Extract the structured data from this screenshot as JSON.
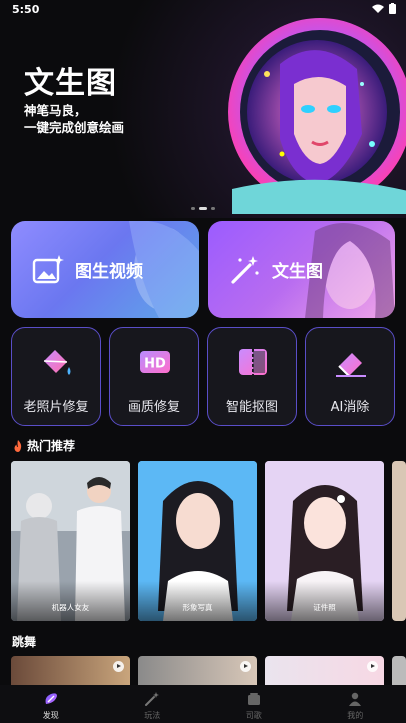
{
  "status_bar": {
    "time": "5:50"
  },
  "hero": {
    "title": "文生图",
    "subtitle_line1": "神笔马良，",
    "subtitle_line2": "一键完成创意绘画"
  },
  "features": [
    {
      "label": "图生视频",
      "icon": "image-sparkle-icon"
    },
    {
      "label": "文生图",
      "icon": "magic-wand-icon"
    }
  ],
  "tools": [
    {
      "label": "老照片修复",
      "icon": "paint-bucket-icon"
    },
    {
      "label": "画质修复",
      "icon": "hd-icon"
    },
    {
      "label": "智能抠图",
      "icon": "cutout-icon"
    },
    {
      "label": "AI消除",
      "icon": "eraser-icon"
    }
  ],
  "hot_section": {
    "title": "热门推荐",
    "icon": "fire-icon"
  },
  "hot_cards": [
    {
      "label": "机器人女友"
    },
    {
      "label": "形象写真"
    },
    {
      "label": "证件照"
    }
  ],
  "dance_section": {
    "title": "跳舞"
  },
  "nav": [
    {
      "label": "发现",
      "icon": "discover-icon",
      "active": true
    },
    {
      "label": "玩法",
      "icon": "magic-wand-icon",
      "active": false
    },
    {
      "label": "司歌",
      "icon": "folder-icon",
      "active": false
    },
    {
      "label": "我的",
      "icon": "person-icon",
      "active": false
    }
  ],
  "colors": {
    "accent_purple": "#7b5cff",
    "tool_border": "#5a4ec8",
    "background": "#0b0b0d"
  }
}
